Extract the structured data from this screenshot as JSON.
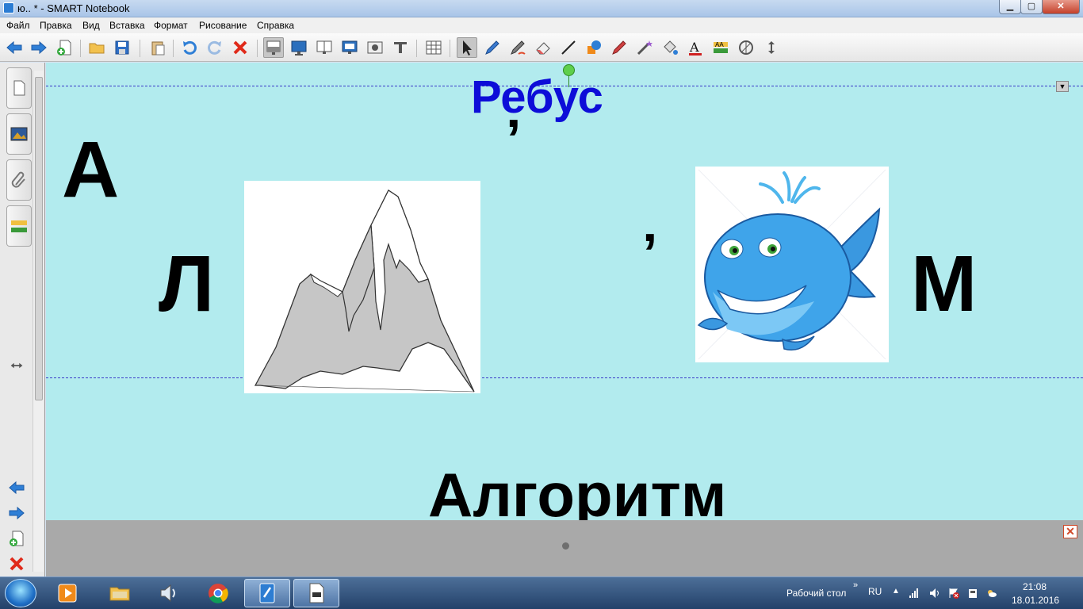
{
  "window": {
    "title": "ю.. * - SMART Notebook",
    "min_label": "▁",
    "max_label": "▢",
    "close_label": "✕"
  },
  "menu": [
    {
      "label": "Файл"
    },
    {
      "label": "Правка"
    },
    {
      "label": "Вид"
    },
    {
      "label": "Вставка"
    },
    {
      "label": "Формат"
    },
    {
      "label": "Рисование"
    },
    {
      "label": "Справка"
    }
  ],
  "toolbar": {
    "icons": [
      "back-arrow-icon",
      "forward-arrow-icon",
      "add-page-icon",
      "open-folder-icon",
      "save-icon",
      "paste-icon",
      "undo-icon",
      "redo-icon",
      "delete-icon",
      "screen-shade-icon",
      "full-screen-icon",
      "dual-page-icon",
      "display-icon",
      "screen-capture-icon",
      "table-icon",
      "select-arrow-icon",
      "pen-icon",
      "creative-pen-icon",
      "eraser-icon",
      "line-icon",
      "shapes-icon",
      "magic-pen-icon",
      "fill-icon",
      "text-icon",
      "properties-icon",
      "measurement-tools-icon",
      "move-toolbar-icon"
    ],
    "active_tool": "screen-shade-icon"
  },
  "side_panel": {
    "tabs": [
      "page-sorter-icon",
      "gallery-icon",
      "attachments-icon",
      "properties-icon"
    ]
  },
  "canvas": {
    "background": "#b2ebee",
    "title": "Ребус",
    "title_color": "#0d0dd8",
    "puzzle": {
      "letter_a": "А",
      "comma_top": "’",
      "letter_l": "Л",
      "comma_mid": "’",
      "letter_m": "М",
      "images": [
        "mountain-image",
        "whale-image"
      ]
    },
    "answer": "Алгоритм"
  },
  "tray": {
    "close_label": "✕"
  },
  "taskbar": {
    "apps": [
      "media-player-icon",
      "file-explorer-icon",
      "volume-app-icon",
      "chrome-icon",
      "smart-notebook-icon",
      "document-icon"
    ],
    "desktop_label": "Рабочий стол",
    "desktop_chevron": "»",
    "language": "RU",
    "time": "21:08",
    "date": "18.01.2016"
  }
}
